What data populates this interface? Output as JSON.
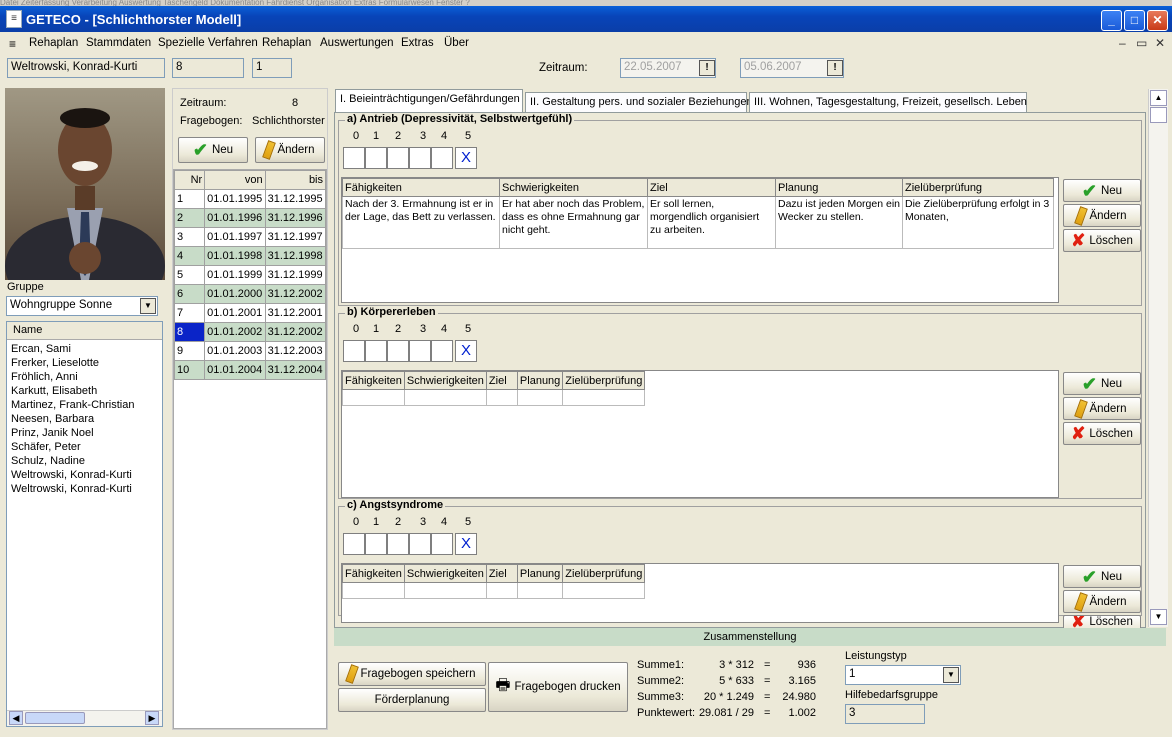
{
  "bg_menu": "Datei  Zeiterfassung  Verarbeitung  Auswertung  Taschengeld  Dokumentation  Fahrdienst  Organisation  Extras  Formularwesen  Fenster  ?",
  "window": {
    "app": "GETECO",
    "doc": " - [Schlichthorster Modell]",
    "min": "_",
    "max": "□",
    "close": "✕"
  },
  "menu": [
    "Rehaplan",
    "Stammdaten",
    "Spezielle Verfahren",
    "Rehaplan",
    "Auswertungen",
    "Extras",
    "Über"
  ],
  "top": {
    "client": "Weltrowski, Konrad-Kurti",
    "num1": "8",
    "num2": "1",
    "zeitraum_label": "Zeitraum:",
    "date_from": "22.05.2007",
    "date_to": "05.06.2007"
  },
  "group": {
    "label": "Gruppe",
    "value": "Wohngruppe Sonne",
    "name_header": "Name",
    "names": [
      "Ercan, Sami",
      "Frerker, Lieselotte",
      "Fröhlich, Anni",
      "Karkutt, Elisabeth",
      "Martinez, Frank-Christian",
      "Neesen, Barbara",
      "Prinz, Janik Noel",
      "Schäfer, Peter",
      "Schulz, Nadine",
      "Weltrowski, Konrad-Kurti",
      "Weltrowski, Konrad-Kurti"
    ]
  },
  "mid": {
    "zeitraum_label": "Zeitraum:",
    "zeitraum_val": "8",
    "fragebogen_label": "Fragebogen:",
    "fragebogen_val": "Schlichthorster",
    "neu": "Neu",
    "aendern": "Ändern",
    "cols": [
      "Nr",
      "von",
      "bis"
    ],
    "rows": [
      [
        "1",
        "01.01.1995",
        "31.12.1995"
      ],
      [
        "2",
        "01.01.1996",
        "31.12.1996"
      ],
      [
        "3",
        "01.01.1997",
        "31.12.1997"
      ],
      [
        "4",
        "01.01.1998",
        "31.12.1998"
      ],
      [
        "5",
        "01.01.1999",
        "31.12.1999"
      ],
      [
        "6",
        "01.01.2000",
        "31.12.2002"
      ],
      [
        "7",
        "01.01.2001",
        "31.12.2001"
      ],
      [
        "8",
        "01.01.2002",
        "31.12.2002"
      ],
      [
        "9",
        "01.01.2003",
        "31.12.2003"
      ],
      [
        "10",
        "01.01.2004",
        "31.12.2004"
      ]
    ]
  },
  "tabs": [
    "I. Beieinträchtigungen/Gefährdungen",
    "II. Gestaltung pers. und sozialer Beziehungen",
    "III. Wohnen, Tagesgestaltung, Freizeit, gesellsch. Leben"
  ],
  "scale": [
    "0",
    "1",
    "2",
    "3",
    "4",
    "5"
  ],
  "cols": [
    "Fähigkeiten",
    "Schwierigkeiten",
    "Ziel",
    "Planung",
    "Zielüberprüfung"
  ],
  "sections": [
    {
      "title": "a) Antrieb (Depressivität, Selbstwertgefühl)",
      "row": [
        "Nach der 3. Ermahnung ist er in der Lage, das Bett zu verlassen.",
        "Er hat aber noch das Problem, dass es ohne Ermahnung gar nicht geht.",
        "Er soll lernen, morgendlich organisiert zu arbeiten.",
        "Dazu ist jeden Morgen ein Wecker zu stellen.",
        "Die Zielüberprüfung erfolgt in 3 Monaten,"
      ]
    },
    {
      "title": "b) Körpererleben"
    },
    {
      "title": "c) Angstsyndrome"
    }
  ],
  "buttons": {
    "neu": "Neu",
    "aendern": "Ändern",
    "loeschen": "Löschen"
  },
  "mark": "X",
  "bottom": {
    "header": "Zusammenstellung",
    "save": "Fragebogen speichern",
    "foerder": "Förderplanung",
    "print": "Fragebogen drucken",
    "sums": [
      [
        "Summe1:",
        "3 * 312",
        "=",
        "936"
      ],
      [
        "Summe2:",
        "5 * 633",
        "=",
        "3.165"
      ],
      [
        "Summe3:",
        "20 * 1.249",
        "=",
        "24.980"
      ],
      [
        "Punktewert:",
        "29.081 / 29",
        "=",
        "1.002"
      ]
    ],
    "leistung_label": "Leistungstyp",
    "leistung_val": "1",
    "hilfe_label": "Hilfebedarfsgruppe",
    "hilfe_val": "3"
  }
}
